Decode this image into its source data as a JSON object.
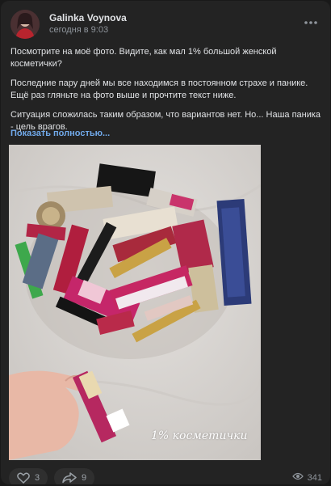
{
  "post": {
    "author": "Galinka Voynova",
    "timestamp": "сегодня в 9:03",
    "more_icon": "ellipsis-icon",
    "paragraphs": [
      "Посмотрите на моё фото. Видите, как мал 1% большой женской косметички?",
      "Последние пару дней мы все находимся в постоянном страхе и панике. Ещё раз гляньте на фото выше и прочтите текст ниже.",
      "Ситуация сложилась таким образом, что вариантов нет. Но... Наша паника - цель врагов."
    ],
    "show_more": "Показать полностью...",
    "photo_caption": "1% косметички"
  },
  "footer": {
    "likes": "3",
    "shares": "9",
    "views": "341",
    "like_icon": "heart-icon",
    "share_icon": "share-arrow-icon",
    "views_icon": "eye-icon"
  },
  "colors": {
    "background": "#191919",
    "card": "#232323",
    "text": "#e1e3e6",
    "secondary_text": "#8f959c",
    "link": "#71aaeb"
  }
}
